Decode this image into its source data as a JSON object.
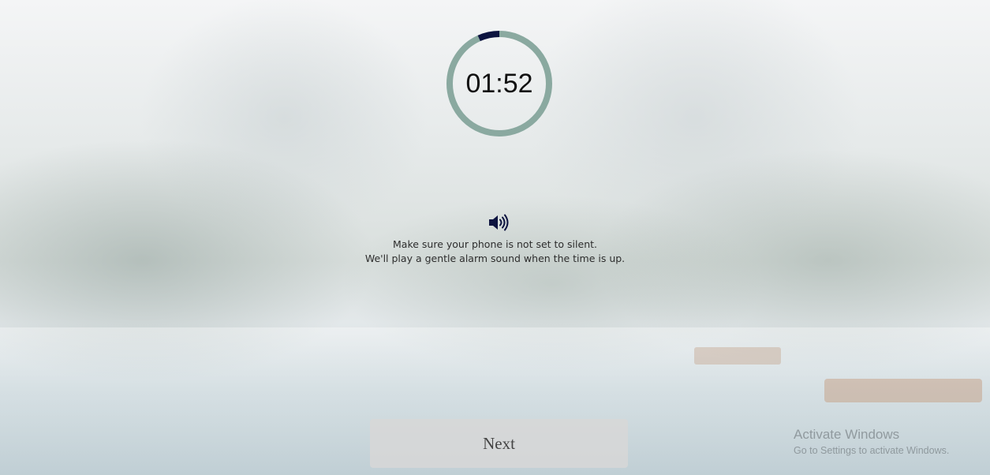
{
  "timer": {
    "display": "01:52",
    "remaining_fraction": 0.933,
    "colors": {
      "remaining": "#8aa9a0",
      "elapsed": "#0d1440"
    }
  },
  "notice": {
    "icon": "volume-icon",
    "line1": "Make sure your phone is not set to silent.",
    "line2": "We'll play a gentle alarm sound when the time is up."
  },
  "actions": {
    "next_label": "Next"
  },
  "watermark": {
    "title": "Activate Windows",
    "subtitle": "Go to Settings to activate Windows."
  }
}
